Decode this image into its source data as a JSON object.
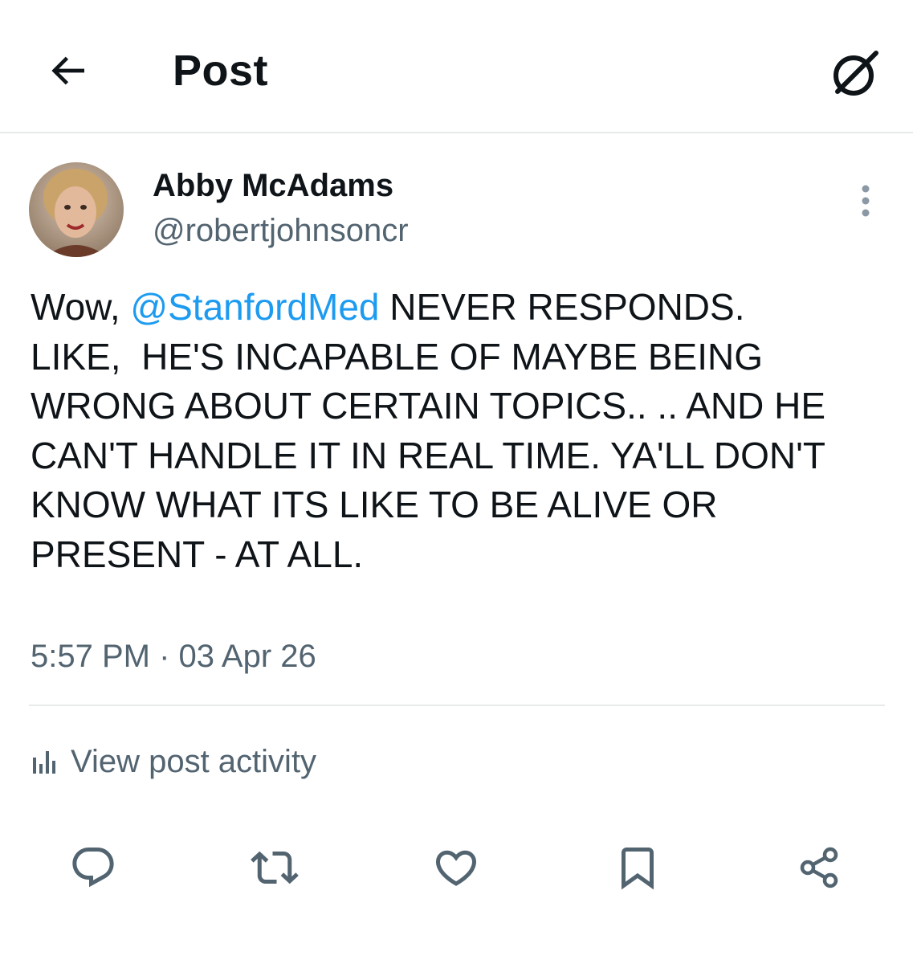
{
  "header": {
    "title": "Post",
    "back_icon": "arrow-left-icon",
    "grok_icon": "grok-icon"
  },
  "author": {
    "name": "Abby McAdams",
    "handle": "@robertjohnsoncr"
  },
  "post": {
    "text_before_mention": "Wow, ",
    "mention": "@StanfordMed",
    "text_after_mention": " NEVER RESPONDS.\nLIKE,  HE'S INCAPABLE OF MAYBE BEING WRONG ABOUT CERTAIN TOPICS.. .. AND HE CAN'T HANDLE IT IN REAL TIME. YA'LL DON'T KNOW WHAT ITS LIKE TO BE ALIVE OR PRESENT - AT ALL.",
    "timestamp": "5:57 PM · 03 Apr 26"
  },
  "activity": {
    "label": "View post activity"
  },
  "actions": [
    "reply-icon",
    "repost-icon",
    "like-icon",
    "bookmark-icon",
    "share-icon"
  ],
  "colors": {
    "text": "#0f1419",
    "secondary": "#536471",
    "link": "#1d9bf0",
    "divider": "#e7e9ea"
  }
}
